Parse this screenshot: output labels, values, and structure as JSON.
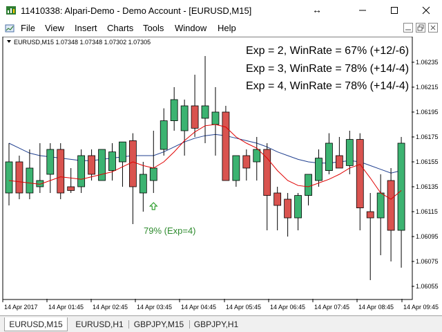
{
  "window": {
    "title": "11410338: Alpari-Demo - Demo Account - [EURUSD,M15]"
  },
  "menu": [
    "File",
    "View",
    "Insert",
    "Charts",
    "Tools",
    "Window",
    "Help"
  ],
  "chart": {
    "header": "EURUSD,M15  1.07348 1.07348 1.07302 1.07305",
    "stats": [
      "Exp = 2, WinRate = 67% (+12/-6)",
      "Exp = 3, WinRate = 78% (+14/-4)",
      "Exp = 4, WinRate = 78% (+14/-4)"
    ],
    "annotation": "79% (Exp=4)",
    "colors": {
      "bull": "#3cb371",
      "bear": "#d9534f",
      "ma_fast": "#e00000",
      "ma_slow": "#1f3f8f",
      "annotation": "#2e8b2e",
      "signal_arrow": "#2e9e2e"
    }
  },
  "chart_data": {
    "type": "candlestick",
    "symbol": "EURUSD",
    "timeframe": "M15",
    "price_ticks": [
      "1.06235",
      "1.06215",
      "1.06195",
      "1.06175",
      "1.06155",
      "1.06135",
      "1.06115",
      "1.06095",
      "1.06075",
      "1.06055"
    ],
    "time_ticks": [
      "14 Apr 2017",
      "14 Apr 01:45",
      "14 Apr 02:45",
      "14 Apr 03:45",
      "14 Apr 04:45",
      "14 Apr 05:45",
      "14 Apr 06:45",
      "14 Apr 07:45",
      "14 Apr 08:45",
      "14 Apr 09:45"
    ],
    "ylim": [
      1.06045,
      1.06255
    ],
    "candles": [
      {
        "o": 1.0613,
        "h": 1.0617,
        "l": 1.0612,
        "c": 1.06155
      },
      {
        "o": 1.06155,
        "h": 1.0616,
        "l": 1.06125,
        "c": 1.0613
      },
      {
        "o": 1.0613,
        "h": 1.06165,
        "l": 1.06125,
        "c": 1.0615
      },
      {
        "o": 1.06135,
        "h": 1.0617,
        "l": 1.0613,
        "c": 1.0614
      },
      {
        "o": 1.06145,
        "h": 1.0617,
        "l": 1.0613,
        "c": 1.06165
      },
      {
        "o": 1.06165,
        "h": 1.0617,
        "l": 1.06125,
        "c": 1.0613
      },
      {
        "o": 1.06135,
        "h": 1.0615,
        "l": 1.0613,
        "c": 1.06132
      },
      {
        "o": 1.06135,
        "h": 1.06165,
        "l": 1.0613,
        "c": 1.0616
      },
      {
        "o": 1.0616,
        "h": 1.06165,
        "l": 1.0614,
        "c": 1.06145
      },
      {
        "o": 1.0614,
        "h": 1.06165,
        "l": 1.0614,
        "c": 1.06165
      },
      {
        "o": 1.06148,
        "h": 1.0617,
        "l": 1.0614,
        "c": 1.06163
      },
      {
        "o": 1.06155,
        "h": 1.0617,
        "l": 1.06135,
        "c": 1.06171
      },
      {
        "o": 1.06172,
        "h": 1.06178,
        "l": 1.06105,
        "c": 1.06135
      },
      {
        "o": 1.0613,
        "h": 1.06155,
        "l": 1.06115,
        "c": 1.06145
      },
      {
        "o": 1.0614,
        "h": 1.0618,
        "l": 1.0613,
        "c": 1.0615
      },
      {
        "o": 1.06165,
        "h": 1.06198,
        "l": 1.0616,
        "c": 1.06188
      },
      {
        "o": 1.06188,
        "h": 1.06215,
        "l": 1.0618,
        "c": 1.06205
      },
      {
        "o": 1.0618,
        "h": 1.06205,
        "l": 1.0616,
        "c": 1.062
      },
      {
        "o": 1.062,
        "h": 1.06225,
        "l": 1.06175,
        "c": 1.06182
      },
      {
        "o": 1.0619,
        "h": 1.0624,
        "l": 1.0617,
        "c": 1.062
      },
      {
        "o": 1.06185,
        "h": 1.06215,
        "l": 1.0616,
        "c": 1.06195
      },
      {
        "o": 1.06195,
        "h": 1.062,
        "l": 1.0615,
        "c": 1.0614
      },
      {
        "o": 1.0614,
        "h": 1.0616,
        "l": 1.06135,
        "c": 1.0616
      },
      {
        "o": 1.0616,
        "h": 1.06165,
        "l": 1.0614,
        "c": 1.0615
      },
      {
        "o": 1.06155,
        "h": 1.06175,
        "l": 1.0614,
        "c": 1.06165
      },
      {
        "o": 1.06165,
        "h": 1.0617,
        "l": 1.061,
        "c": 1.06128
      },
      {
        "o": 1.0613,
        "h": 1.06135,
        "l": 1.061,
        "c": 1.0612
      },
      {
        "o": 1.06125,
        "h": 1.0613,
        "l": 1.06095,
        "c": 1.0611
      },
      {
        "o": 1.0611,
        "h": 1.0613,
        "l": 1.061,
        "c": 1.06128
      },
      {
        "o": 1.06128,
        "h": 1.06145,
        "l": 1.0612,
        "c": 1.06145
      },
      {
        "o": 1.0614,
        "h": 1.06165,
        "l": 1.06135,
        "c": 1.06158
      },
      {
        "o": 1.06148,
        "h": 1.06178,
        "l": 1.06145,
        "c": 1.0617
      },
      {
        "o": 1.0616,
        "h": 1.06175,
        "l": 1.0615,
        "c": 1.0615
      },
      {
        "o": 1.06152,
        "h": 1.0618,
        "l": 1.06145,
        "c": 1.06173
      },
      {
        "o": 1.06173,
        "h": 1.06178,
        "l": 1.061,
        "c": 1.06118
      },
      {
        "o": 1.06115,
        "h": 1.0613,
        "l": 1.0606,
        "c": 1.0611
      },
      {
        "o": 1.0611,
        "h": 1.06145,
        "l": 1.0608,
        "c": 1.0613
      },
      {
        "o": 1.0614,
        "h": 1.0615,
        "l": 1.06075,
        "c": 1.061
      },
      {
        "o": 1.061,
        "h": 1.06175,
        "l": 1.0607,
        "c": 1.0617
      }
    ],
    "ma_fast": [
      1.0614,
      1.06139,
      1.06138,
      1.06137,
      1.0614,
      1.06143,
      1.06142,
      1.06141,
      1.06143,
      1.06145,
      1.06147,
      1.06151,
      1.06155,
      1.06152,
      1.0615,
      1.06155,
      1.06163,
      1.06172,
      1.06179,
      1.06184,
      1.06185,
      1.06183,
      1.06175,
      1.0617,
      1.06166,
      1.06158,
      1.06148,
      1.0614,
      1.06136,
      1.06135,
      1.06138,
      1.06141,
      1.06145,
      1.0615,
      1.06153,
      1.06142,
      1.0613,
      1.06125,
      1.06132
    ],
    "ma_slow": [
      1.0617,
      1.06166,
      1.06162,
      1.0616,
      1.06159,
      1.06158,
      1.06157,
      1.06156,
      1.06156,
      1.06157,
      1.06158,
      1.06159,
      1.0616,
      1.0616,
      1.0616,
      1.06163,
      1.06167,
      1.06171,
      1.06174,
      1.06176,
      1.06177,
      1.06176,
      1.06174,
      1.06172,
      1.0617,
      1.06167,
      1.06163,
      1.0616,
      1.06157,
      1.06155,
      1.06154,
      1.06154,
      1.06155,
      1.06156,
      1.06155,
      1.06152,
      1.06149,
      1.06146,
      1.06148
    ],
    "signal": {
      "candle_index": 14,
      "direction": "up"
    }
  },
  "tabs": [
    "EURUSD,M15",
    "EURUSD,H1",
    "GBPJPY,M15",
    "GBPJPY,H1"
  ],
  "active_tab": 0
}
